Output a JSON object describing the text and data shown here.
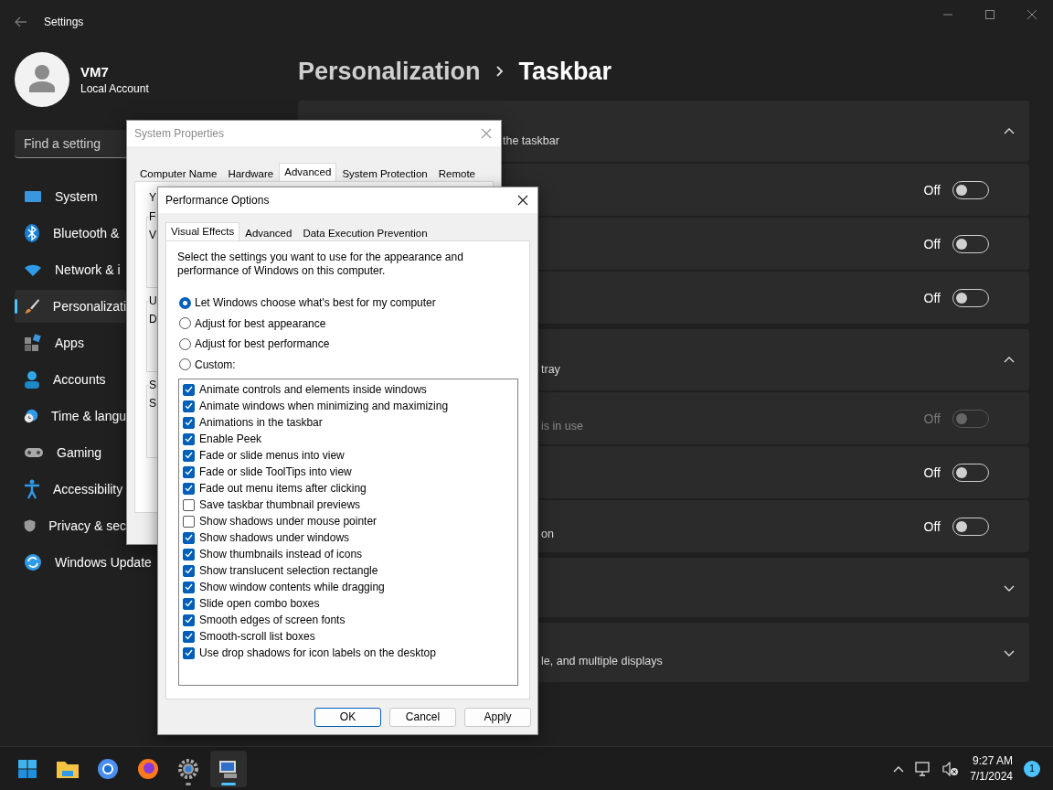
{
  "window": {
    "title": "Settings"
  },
  "account": {
    "name": "VM7",
    "type": "Local Account"
  },
  "search": {
    "placeholder": "Find a setting"
  },
  "nav": [
    {
      "label": "System",
      "selected": false
    },
    {
      "label": "Bluetooth &",
      "selected": false
    },
    {
      "label": "Network & i",
      "selected": false
    },
    {
      "label": "Personalizati",
      "selected": true
    },
    {
      "label": "Apps",
      "selected": false
    },
    {
      "label": "Accounts",
      "selected": false
    },
    {
      "label": "Time & langu",
      "selected": false
    },
    {
      "label": "Gaming",
      "selected": false
    },
    {
      "label": "Accessibility",
      "selected": false
    },
    {
      "label": "Privacy & sec",
      "selected": false
    },
    {
      "label": "Windows Update",
      "selected": false
    }
  ],
  "breadcrumb": {
    "parent": "Personalization",
    "current": "Taskbar"
  },
  "sections": [
    {
      "header": "the taskbar",
      "expanded": true,
      "rows": [
        {
          "toggle": "Off",
          "on": false,
          "disabled": false
        },
        {
          "toggle": "Off",
          "on": false,
          "disabled": false
        },
        {
          "toggle": "Off",
          "on": false,
          "disabled": false
        }
      ]
    },
    {
      "header": "tray",
      "expanded": true,
      "rows": [
        {
          "subtitle": "is in use",
          "toggle": "Off",
          "on": false,
          "disabled": true
        },
        {
          "toggle": "Off",
          "on": false,
          "disabled": false
        },
        {
          "subtitle": "on",
          "toggle": "Off",
          "on": false,
          "disabled": false
        }
      ]
    },
    {
      "expanded": false
    },
    {
      "header": "le, and multiple displays",
      "expanded": false
    }
  ],
  "system_properties": {
    "title": "System Properties",
    "tabs": [
      {
        "label": "Computer Name",
        "selected": false
      },
      {
        "label": "Hardware",
        "selected": false
      },
      {
        "label": "Advanced",
        "selected": true
      },
      {
        "label": "System Protection",
        "selected": false
      },
      {
        "label": "Remote",
        "selected": false
      }
    ],
    "intro": "Y",
    "groups": [
      {
        "label": "F",
        "line": "V"
      },
      {
        "label": "U",
        "line": "D"
      },
      {
        "label": "S",
        "line": "S"
      }
    ]
  },
  "performance_options": {
    "title": "Performance Options",
    "tabs": [
      {
        "label": "Visual Effects",
        "selected": true
      },
      {
        "label": "Advanced",
        "selected": false
      },
      {
        "label": "Data Execution Prevention",
        "selected": false
      }
    ],
    "description": "Select the settings you want to use for the appearance and performance of Windows on this computer.",
    "radios": [
      {
        "label": "Let Windows choose what's best for my computer",
        "selected": true
      },
      {
        "label": "Adjust for best appearance",
        "selected": false
      },
      {
        "label": "Adjust for best performance",
        "selected": false
      },
      {
        "label": "Custom:",
        "selected": false
      }
    ],
    "effects": [
      {
        "label": "Animate controls and elements inside windows",
        "checked": true
      },
      {
        "label": "Animate windows when minimizing and maximizing",
        "checked": true
      },
      {
        "label": "Animations in the taskbar",
        "checked": true
      },
      {
        "label": "Enable Peek",
        "checked": true
      },
      {
        "label": "Fade or slide menus into view",
        "checked": true
      },
      {
        "label": "Fade or slide ToolTips into view",
        "checked": true
      },
      {
        "label": "Fade out menu items after clicking",
        "checked": true
      },
      {
        "label": "Save taskbar thumbnail previews",
        "checked": false
      },
      {
        "label": "Show shadows under mouse pointer",
        "checked": false
      },
      {
        "label": "Show shadows under windows",
        "checked": true
      },
      {
        "label": "Show thumbnails instead of icons",
        "checked": true
      },
      {
        "label": "Show translucent selection rectangle",
        "checked": true
      },
      {
        "label": "Show window contents while dragging",
        "checked": true
      },
      {
        "label": "Slide open combo boxes",
        "checked": true
      },
      {
        "label": "Smooth edges of screen fonts",
        "checked": true
      },
      {
        "label": "Smooth-scroll list boxes",
        "checked": true
      },
      {
        "label": "Use drop shadows for icon labels on the desktop",
        "checked": true
      }
    ],
    "buttons": [
      {
        "label": "OK",
        "default": true
      },
      {
        "label": "Cancel",
        "default": false
      },
      {
        "label": "Apply",
        "default": false
      }
    ]
  },
  "taskbar": {
    "apps": [
      {
        "open": false,
        "selected": false
      },
      {
        "open": false,
        "selected": false
      },
      {
        "open": false,
        "selected": false
      },
      {
        "open": false,
        "selected": false
      },
      {
        "open": true,
        "selected": false
      },
      {
        "open": true,
        "selected": true
      }
    ],
    "time": "9:27 AM",
    "date": "7/1/2024",
    "badge": "1"
  }
}
